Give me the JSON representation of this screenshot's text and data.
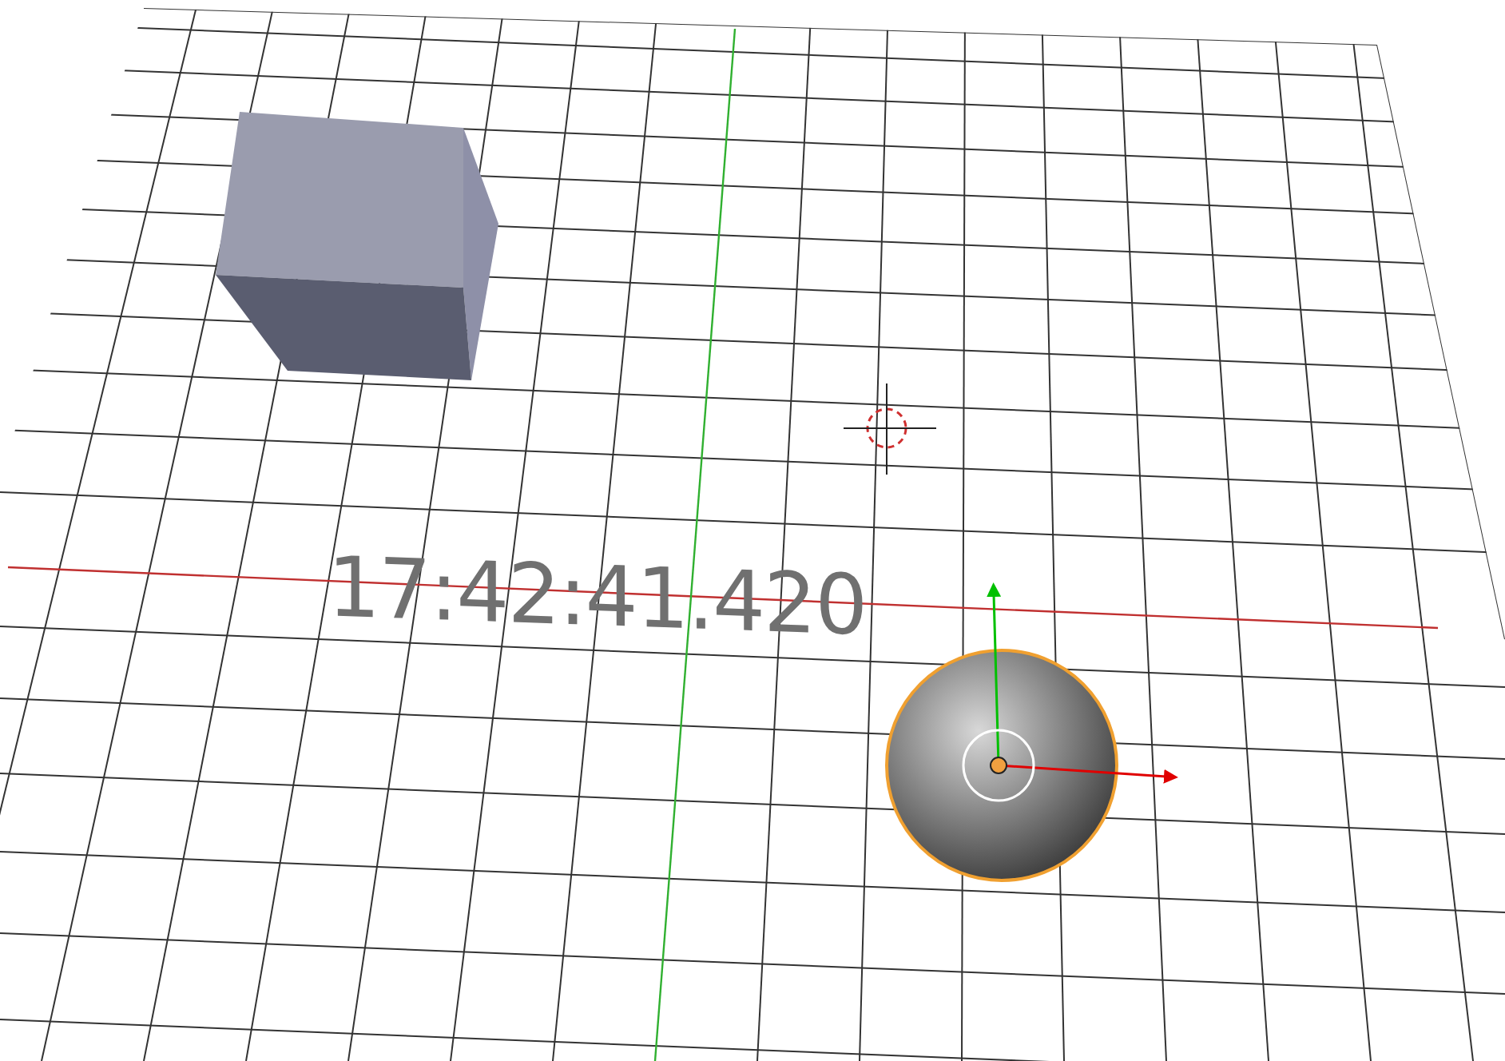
{
  "viewport": {
    "scene_text": "17:42:41.420",
    "objects": [
      {
        "kind": "cube",
        "selected": false
      },
      {
        "kind": "sphere",
        "selected": true
      }
    ]
  }
}
